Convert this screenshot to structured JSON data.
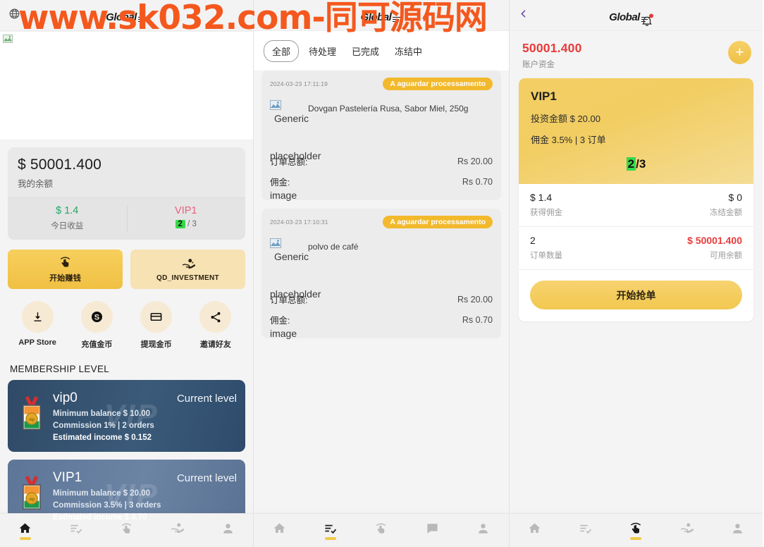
{
  "watermark": {
    "text": "www.sk032.com-同可源码网",
    "color": "#f4581d"
  },
  "brand": {
    "name": "Global"
  },
  "left_panel": {
    "topbar": {
      "globe_icon": "globe-icon"
    },
    "banner": {
      "alt": ""
    },
    "balance": {
      "amount": "$ 50001.400",
      "label": "我的余额",
      "today_income_value": "$ 1.4",
      "today_income_label": "今日收益",
      "vip_level": "VIP1",
      "orders_done": "2",
      "orders_total": "/ 3"
    },
    "cta": [
      {
        "label": "开始赚钱",
        "icon": "tap-hand-icon",
        "style": "primary"
      },
      {
        "label": "QD_INVESTMENT",
        "icon": "hand-money-icon",
        "style": "secondary"
      }
    ],
    "quick_actions": [
      {
        "label": "APP Store",
        "icon": "download-icon"
      },
      {
        "label": "充值金币",
        "icon": "dollar-coin-icon"
      },
      {
        "label": "提现金币",
        "icon": "credit-card-icon"
      },
      {
        "label": "邀请好友",
        "icon": "share-icon"
      }
    ],
    "section_title": "MEMBERSHIP LEVEL",
    "vip_watermark": "VIP",
    "vip_cards": [
      {
        "name": "vip0",
        "status": "Current level",
        "min_balance": "Minimum balance $ 10.00",
        "commission": "Commission 1% | 2 orders",
        "estimated": "Estimated income $ 0.152"
      },
      {
        "name": "VIP1",
        "status": "Current level",
        "min_balance": "Minimum balance $ 20.00",
        "commission": "Commission 3.5% | 3 orders",
        "estimated": "Estimated income $ 0.70"
      }
    ],
    "bottom_nav": [
      {
        "icon": "home-icon",
        "active": true
      },
      {
        "icon": "list-check-icon",
        "active": false
      },
      {
        "icon": "tap-hand-icon",
        "active": false
      },
      {
        "icon": "hand-money-icon",
        "active": false
      },
      {
        "icon": "person-icon",
        "active": false
      }
    ]
  },
  "mid_panel": {
    "filters": [
      {
        "label": "全部",
        "active": true
      },
      {
        "label": "待处理",
        "active": false
      },
      {
        "label": "已完成",
        "active": false
      },
      {
        "label": "冻结中",
        "active": false
      }
    ],
    "broken_alt": {
      "generic": "Generic",
      "placeholder": "placeholder",
      "image": "image"
    },
    "orders": [
      {
        "time": "2024-03-23 17:11:19",
        "status": "A aguardar processamento",
        "title": "Dovgan Pastelería Rusa, Sabor Miel, 250g",
        "total_key": "订单总额:",
        "total_val": "Rs 20.00",
        "commission_key": "佣金:",
        "commission_val": "Rs 0.70"
      },
      {
        "time": "2024-03-23 17:10:31",
        "status": "A aguardar processamento",
        "title": "polvo de café",
        "total_key": "订单总额:",
        "total_val": "Rs 20.00",
        "commission_key": "佣金:",
        "commission_val": "Rs 0.70"
      }
    ],
    "bottom_nav": [
      {
        "icon": "home-icon",
        "active": false
      },
      {
        "icon": "list-check-icon",
        "active": true
      },
      {
        "icon": "tap-hand-icon",
        "active": false
      },
      {
        "icon": "chat-icon",
        "active": false
      },
      {
        "icon": "person-icon",
        "active": false
      }
    ]
  },
  "right_panel": {
    "topbar": {
      "back_icon": "back-chevron-icon",
      "bell_icon": "bell-icon",
      "has_notification": true
    },
    "account": {
      "amount": "50001.400",
      "label": "账户资金",
      "add_button": "+"
    },
    "vip": {
      "title": "VIP1",
      "investment": "投资金额 $ 20.00",
      "commission": "佣金 3.5% | 3 订单",
      "progress_done": "2",
      "progress_total": "/3"
    },
    "stats": [
      {
        "value": "$ 1.4",
        "label": "获得佣金",
        "red": false
      },
      {
        "value": "$ 0",
        "label": "冻结金额",
        "red": false
      },
      {
        "value": "2",
        "label": "订单数量",
        "red": false
      },
      {
        "value": "$ 50001.400",
        "label": "可用余额",
        "red": true
      }
    ],
    "action_button": "开始抢单",
    "bottom_nav": [
      {
        "icon": "home-icon",
        "active": false
      },
      {
        "icon": "list-check-icon",
        "active": false
      },
      {
        "icon": "tap-hand-icon",
        "active": true
      },
      {
        "icon": "hand-money-icon",
        "active": false
      },
      {
        "icon": "person-icon",
        "active": false
      }
    ]
  }
}
